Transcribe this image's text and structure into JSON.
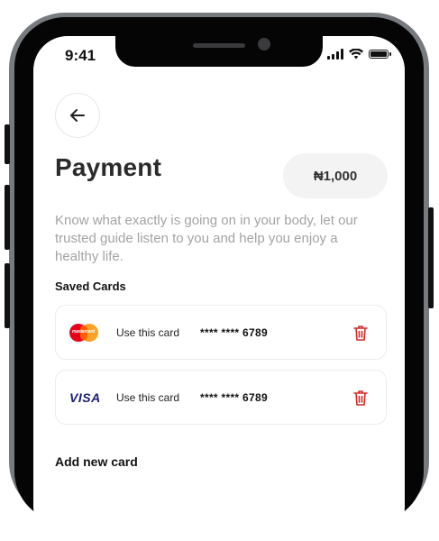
{
  "status_bar": {
    "time": "9:41",
    "icons": [
      "signal-icon",
      "wifi-icon",
      "battery-icon"
    ]
  },
  "header": {
    "back_icon": "arrow-left-icon",
    "title": "Payment",
    "amount": "₦1,000"
  },
  "description": "Know what exactly is going on in your body, let our trusted guide listen to you and help you enjoy a healthy life.",
  "saved_cards": {
    "label": "Saved Cards",
    "cards": [
      {
        "brand": "mastercard",
        "brand_text": "mastercard",
        "use_label": "Use this card",
        "number": "**** **** 6789",
        "delete_icon": "trash-icon"
      },
      {
        "brand": "visa",
        "brand_text": "VISA",
        "use_label": "Use this card",
        "number": "**** **** 6789",
        "delete_icon": "trash-icon"
      }
    ]
  },
  "add_new": {
    "label": "Add new card"
  },
  "colors": {
    "title": "#2b2b2b",
    "muted_text": "#a3a3a3",
    "delete": "#d62828",
    "mastercard_red": "#eb001b",
    "mastercard_orange": "#f79e1b",
    "visa_blue": "#1a1f71"
  }
}
